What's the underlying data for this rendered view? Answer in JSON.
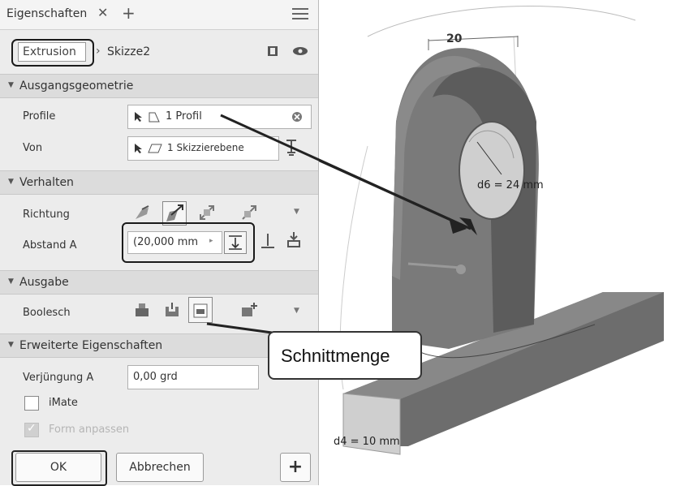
{
  "tab": {
    "title": "Eigenschaften",
    "close_glyph": "✕",
    "plus_glyph": "+"
  },
  "breadcrumb": {
    "feature": "Extrusion",
    "sketch": "Skizze2"
  },
  "sections": {
    "ausgang": "Ausgangsgeometrie",
    "verhalten": "Verhalten",
    "ausgabe": "Ausgabe",
    "erweitert": "Erweiterte Eigenschaften"
  },
  "fields": {
    "profile_label": "Profile",
    "profile_value": "1 Profil",
    "von_label": "Von",
    "von_value": "1 Skizzierebene",
    "richtung_label": "Richtung",
    "abstand_label": "Abstand A",
    "abstand_value": "(20,000 mm",
    "boolesch_label": "Boolesch",
    "verjuengung_label": "Verjüngung A",
    "verjuengung_value": "0,00 grd",
    "imate_label": "iMate",
    "form_label": "Form anpassen"
  },
  "buttons": {
    "ok": "OK",
    "abbrechen": "Abbrechen",
    "plus": "+"
  },
  "viewport": {
    "dim_top": "20",
    "dim_d6": "d6 = 24 mm",
    "dim_d4": "d4 = 10 mm"
  },
  "callout": "Schnittmenge",
  "colors": {
    "panel_bg": "#ececec",
    "section_bg": "#dcdcdc",
    "solid": "#7a7a7a",
    "solid_dark": "#5a5a5a"
  }
}
